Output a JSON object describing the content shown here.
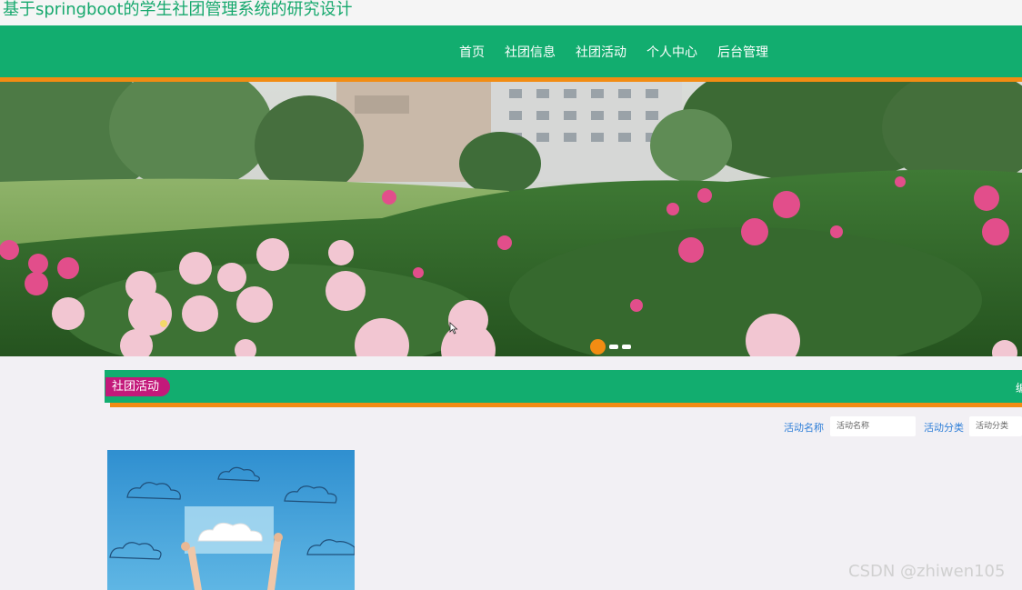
{
  "site": {
    "title": "基于springboot的学生社团管理系统的研究设计"
  },
  "nav": {
    "items": [
      {
        "label": "首页"
      },
      {
        "label": "社团信息"
      },
      {
        "label": "社团活动"
      },
      {
        "label": "个人中心"
      },
      {
        "label": "后台管理"
      }
    ]
  },
  "carousel": {
    "slide_count": 3,
    "active_index": 0
  },
  "section": {
    "title": "社团活动",
    "more": "编"
  },
  "filters": {
    "name_label": "活动名称",
    "name_placeholder": "活动名称",
    "category_label": "活动分类",
    "category_placeholder": "活动分类"
  },
  "watermark": "CSDN @zhiwen105",
  "colors": {
    "primary_green": "#12ad6f",
    "accent_orange": "#f28c13",
    "badge_magenta": "#c3197a",
    "title_green": "#16a86d",
    "label_blue": "#2f7fd8"
  }
}
